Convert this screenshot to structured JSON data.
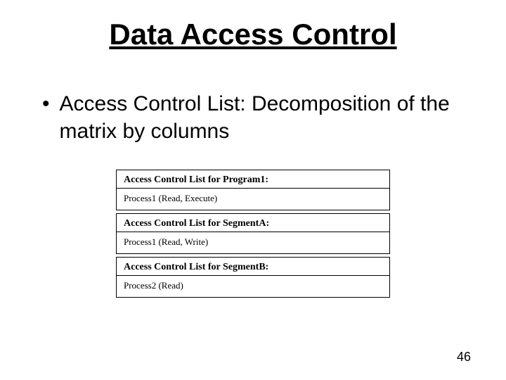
{
  "title": "Data Access Control",
  "bullet": {
    "marker": "•",
    "text": "Access Control List: Decomposition of the matrix by columns"
  },
  "acl_boxes": [
    {
      "header": "Access Control List for Program1:",
      "entry": "Process1 (Read, Execute)"
    },
    {
      "header": "Access Control List for SegmentA:",
      "entry": "Process1 (Read, Write)"
    },
    {
      "header": "Access Control List for SegmentB:",
      "entry": "Process2 (Read)"
    }
  ],
  "page_number": "46"
}
